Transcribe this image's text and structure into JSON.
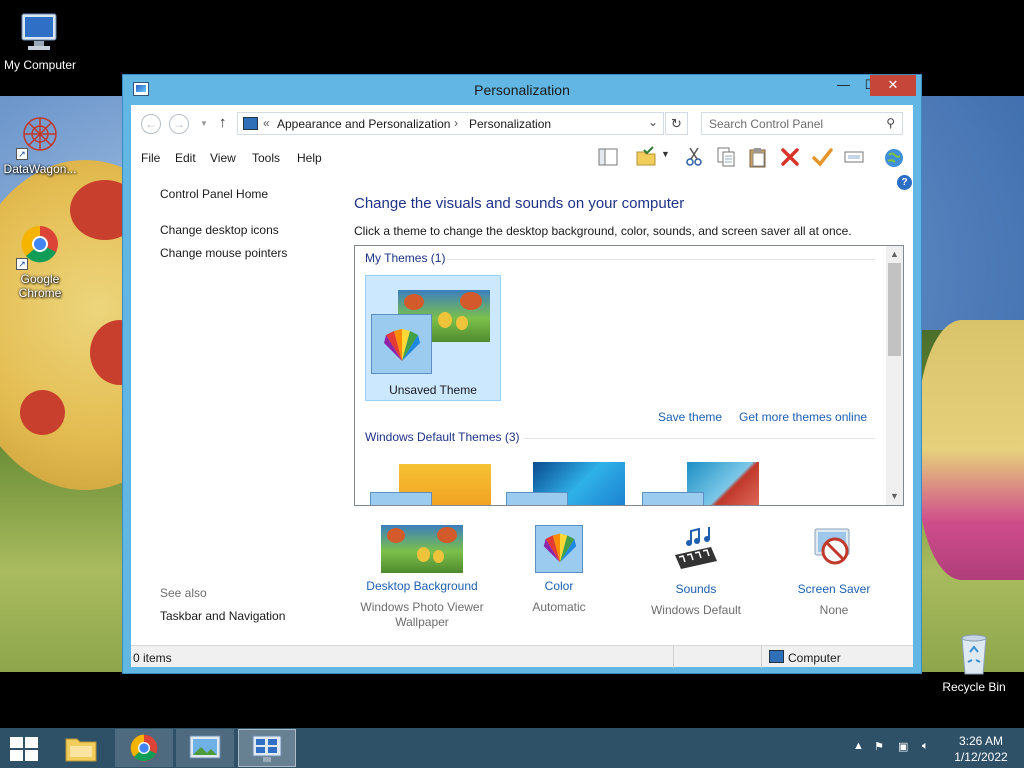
{
  "desktop": {
    "icons": [
      {
        "label": "My Computer"
      },
      {
        "label": "DataWagon..."
      },
      {
        "label": "Google Chrome"
      },
      {
        "label": "Recycle Bin"
      }
    ]
  },
  "window": {
    "title": "Personalization",
    "controls": {
      "minimize": "—",
      "maximize": "☐",
      "close": "✕"
    },
    "address": {
      "prefix": "«",
      "crumbs": [
        "Appearance and Personalization",
        "Personalization"
      ],
      "separator": "›"
    },
    "search": {
      "placeholder": "Search Control Panel"
    },
    "menu": [
      "File",
      "Edit",
      "View",
      "Tools",
      "Help"
    ],
    "left_pane": {
      "home": "Control Panel Home",
      "links": [
        "Change desktop icons",
        "Change mouse pointers"
      ],
      "see_also_title": "See also",
      "see_also_links": [
        "Taskbar and Navigation"
      ]
    },
    "main": {
      "heading": "Change the visuals and sounds on your computer",
      "subheading": "Click a theme to change the desktop background, color, sounds, and screen saver all at once.",
      "my_themes_title": "My Themes (1)",
      "unsaved_theme": "Unsaved Theme",
      "save_theme": "Save theme",
      "get_more": "Get more themes online",
      "default_themes_title": "Windows Default Themes (3)"
    },
    "bottom": [
      {
        "label": "Desktop Background",
        "sub": "Windows Photo Viewer Wallpaper"
      },
      {
        "label": "Color",
        "sub": "Automatic"
      },
      {
        "label": "Sounds",
        "sub": "Windows Default"
      },
      {
        "label": "Screen Saver",
        "sub": "None"
      }
    ],
    "status": {
      "items": "0 items",
      "location": "Computer"
    }
  },
  "taskbar": {
    "clock_time": "3:26 AM",
    "clock_date": "1/12/2022"
  },
  "colors": {
    "accent": "#62b6e4",
    "link": "#1e5fb0",
    "heading": "#1e3287",
    "close": "#c7463a",
    "taskbar": "#2f5168"
  }
}
